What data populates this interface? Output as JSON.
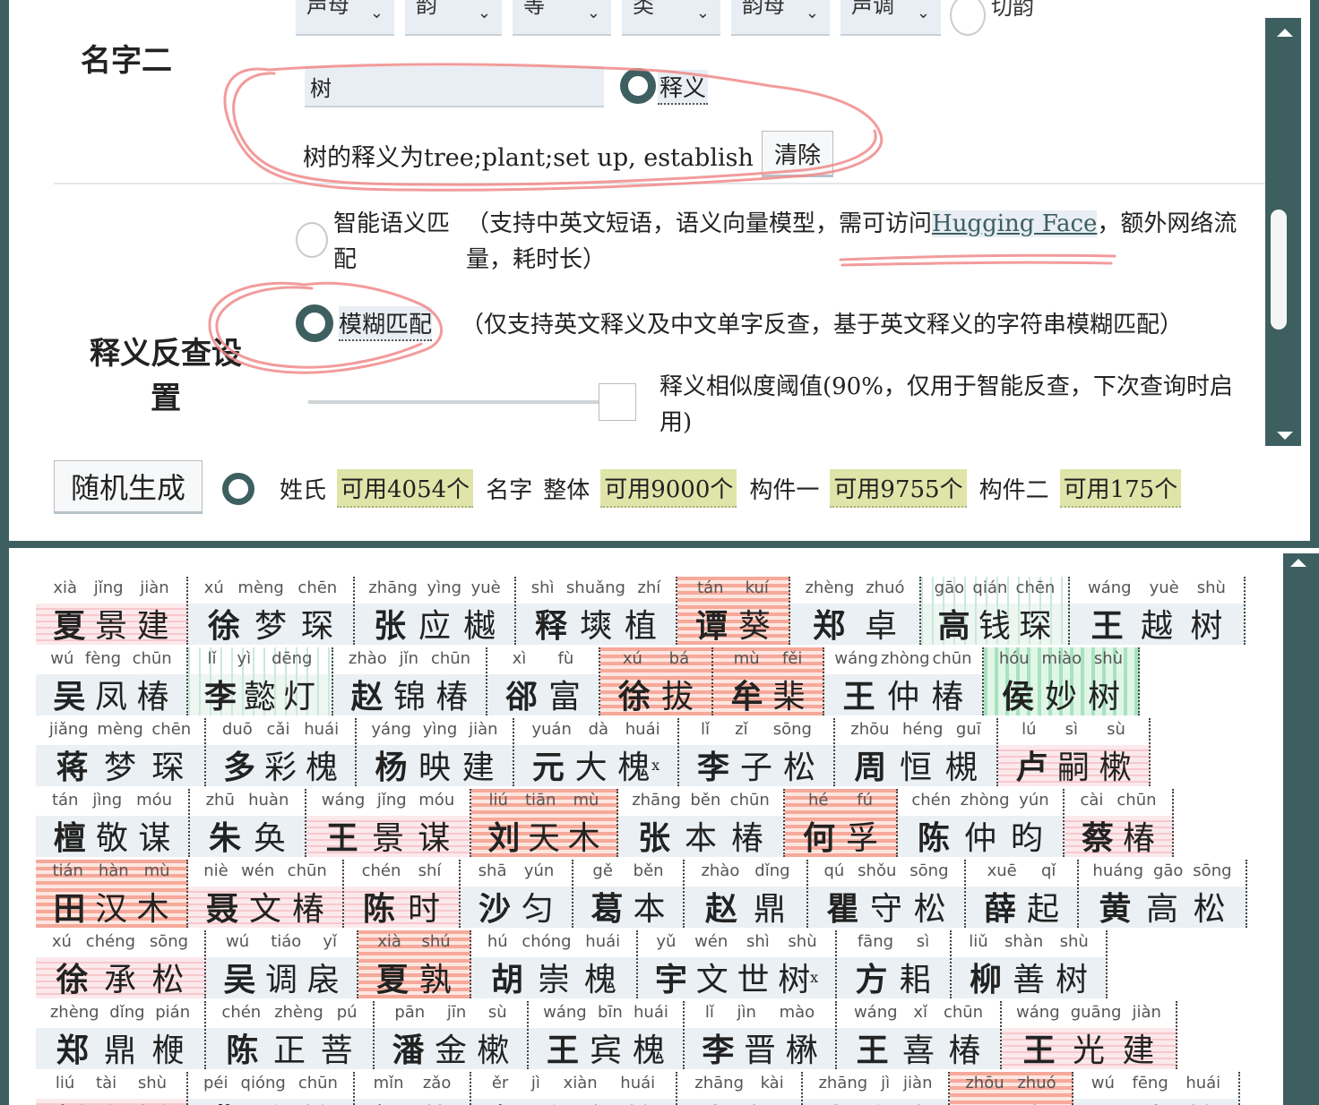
{
  "top": {
    "cut_selects": [
      {
        "label": "声母",
        "left": 0
      },
      {
        "label": "韵",
        "left": 0
      },
      {
        "label": "等",
        "left": 0
      },
      {
        "label": "类",
        "left": 0
      },
      {
        "label": "韵母",
        "left": 0
      },
      {
        "label": "声调",
        "left": 0
      }
    ],
    "cut_radio_label": "切韵",
    "name2_title": "名字二",
    "meaning_input_value": "树",
    "meaning_radio_label": "释义",
    "meaning_result": "树的释义为tree;plant;set up, establish",
    "clear_label": "清除",
    "meaning_setting_title": "释义反查设置",
    "smart_label": "智能语义匹配",
    "smart_desc_before": "（支持中英文短语，语义向量模型，需可访问",
    "smart_desc_link": "Hugging Face",
    "smart_desc_after": "，额外网络流量，耗时长）",
    "fuzzy_label": "模糊匹配",
    "fuzzy_desc": "（仅支持英文释义及中文单字反查，基于英文释义的字符串模糊匹配）",
    "slider_label": "释义相似度阈值(90%，仅用于智能反查，下次查询时启用)",
    "slider_value_percent": 90,
    "random_label": "随机生成",
    "gen_items": [
      {
        "text": "姓氏",
        "type": "plain"
      },
      {
        "text": "可用4054个",
        "type": "badge"
      },
      {
        "text": "名字",
        "type": "plain"
      },
      {
        "text": "整体",
        "type": "plain"
      },
      {
        "text": "可用9000个",
        "type": "badge"
      },
      {
        "text": "构件一",
        "type": "plain"
      },
      {
        "text": "可用9755个",
        "type": "badge"
      },
      {
        "text": "构件二",
        "type": "plain"
      },
      {
        "text": "可用175个",
        "type": "badge"
      }
    ]
  },
  "colors": {
    "accent": "#3d5f60",
    "input_bg": "#e8eef3",
    "badge_bg": "#dfe5a9",
    "red_stripe": "#f6a99a",
    "green_stripe": "#a7e3bd",
    "annotation": "#f08a8a"
  },
  "cards": [
    [
      {
        "py": [
          "xià",
          "jǐng",
          "jiàn"
        ],
        "hz": [
          "夏",
          "景",
          "建"
        ],
        "style": "pink",
        "w": 170
      },
      {
        "py": [
          "xú",
          "mèng",
          "chēn"
        ],
        "hz": [
          "徐",
          "梦",
          "琛"
        ],
        "style": "plain",
        "w": 186
      },
      {
        "py": [
          "zhāng",
          "yìng",
          "yuè"
        ],
        "hz": [
          "张",
          "应",
          "樾"
        ],
        "style": "plain",
        "w": 180
      },
      {
        "py": [
          "shì",
          "shuǎng",
          "zhí"
        ],
        "hz": [
          "释",
          "塽",
          "植"
        ],
        "style": "plain",
        "w": 180
      },
      {
        "py": [
          "tán",
          "kuí"
        ],
        "hz": [
          "谭",
          "葵"
        ],
        "style": "red",
        "w": 126
      },
      {
        "py": [
          "zhèng",
          "zhuó"
        ],
        "hz": [
          "郑",
          "卓"
        ],
        "style": "plain",
        "w": 146
      },
      {
        "py": [
          "gāo",
          "qián",
          "chēn"
        ],
        "hz": [
          "高",
          "钱",
          "琛"
        ],
        "style": "teal",
        "w": 166
      },
      {
        "py": [
          "wáng",
          "yuè",
          "shù"
        ],
        "hz": [
          "王",
          "越",
          "树"
        ],
        "style": "plain",
        "w": 196
      }
    ],
    [
      {
        "py": [
          "wú",
          "fèng",
          "chūn"
        ],
        "hz": [
          "吴",
          "凤",
          "椿"
        ],
        "style": "plain",
        "w": 170
      },
      {
        "py": [
          "lǐ",
          "yì",
          "dēng"
        ],
        "hz": [
          "李",
          "懿",
          "灯"
        ],
        "style": "teal",
        "w": 162
      },
      {
        "py": [
          "zhào",
          "jǐn",
          "chūn"
        ],
        "hz": [
          "赵",
          "锦",
          "椿"
        ],
        "style": "plain",
        "w": 172
      },
      {
        "py": [
          "xì",
          "fù"
        ],
        "hz": [
          "郤",
          "富"
        ],
        "style": "plain",
        "w": 126
      },
      {
        "py": [
          "xú",
          "bá"
        ],
        "hz": [
          "徐",
          "拔"
        ],
        "style": "red",
        "w": 126
      },
      {
        "py": [
          "mù",
          "fěi"
        ],
        "hz": [
          "牟",
          "棐"
        ],
        "style": "red",
        "w": 124
      },
      {
        "py": [
          "wáng",
          "zhòng",
          "chūn"
        ],
        "hz": [
          "王",
          "仲",
          "椿"
        ],
        "style": "plain",
        "w": 178
      },
      {
        "py": [
          "hóu",
          "miào",
          "shù"
        ],
        "hz": [
          "侯",
          "妙",
          "树"
        ],
        "style": "green",
        "w": 174
      }
    ],
    [
      {
        "py": [
          "jiǎng",
          "mèng",
          "chēn"
        ],
        "hz": [
          "蒋",
          "梦",
          "琛"
        ],
        "style": "plain",
        "w": 190
      },
      {
        "py": [
          "duō",
          "cǎi",
          "huái"
        ],
        "hz": [
          "多",
          "彩",
          "槐"
        ],
        "style": "plain",
        "w": 168
      },
      {
        "py": [
          "yáng",
          "yìng",
          "jiàn"
        ],
        "hz": [
          "杨",
          "映",
          "建"
        ],
        "style": "plain",
        "w": 176
      },
      {
        "py": [
          "yuán",
          "dà",
          "huái"
        ],
        "hz": [
          "元",
          "大",
          "槐"
        ],
        "style": "plain",
        "w": 184,
        "mark": "x"
      },
      {
        "py": [
          "lǐ",
          "zǐ",
          "sōng"
        ],
        "hz": [
          "李",
          "子",
          "松"
        ],
        "style": "plain",
        "w": 174
      },
      {
        "py": [
          "zhōu",
          "héng",
          "guī"
        ],
        "hz": [
          "周",
          "恒",
          "槻"
        ],
        "style": "plain",
        "w": 182
      },
      {
        "py": [
          "lú",
          "sì",
          "sù"
        ],
        "hz": [
          "卢",
          "嗣",
          "樕"
        ],
        "style": "pink",
        "w": 170
      }
    ],
    [
      {
        "py": [
          "tán",
          "jìng",
          "móu"
        ],
        "hz": [
          "檀",
          "敬",
          "谋"
        ],
        "style": "plain",
        "w": 172
      },
      {
        "py": [
          "zhū",
          "huàn"
        ],
        "hz": [
          "朱",
          "奂"
        ],
        "style": "plain",
        "w": 130
      },
      {
        "py": [
          "wáng",
          "jǐng",
          "móu"
        ],
        "hz": [
          "王",
          "景",
          "谋"
        ],
        "style": "pink",
        "w": 184
      },
      {
        "py": [
          "liú",
          "tiān",
          "mù"
        ],
        "hz": [
          "刘",
          "天",
          "木"
        ],
        "style": "red",
        "w": 164
      },
      {
        "py": [
          "zhāng",
          "běn",
          "chūn"
        ],
        "hz": [
          "张",
          "本",
          "椿"
        ],
        "style": "plain",
        "w": 186
      },
      {
        "py": [
          "hé",
          "fú"
        ],
        "hz": [
          "何",
          "孚"
        ],
        "style": "red",
        "w": 126
      },
      {
        "py": [
          "chén",
          "zhòng",
          "yún"
        ],
        "hz": [
          "陈",
          "仲",
          "昀"
        ],
        "style": "plain",
        "w": 186
      },
      {
        "py": [
          "cài",
          "chūn"
        ],
        "hz": [
          "蔡",
          "椿"
        ],
        "style": "pink",
        "w": 122
      }
    ],
    [
      {
        "py": [
          "tián",
          "hàn",
          "mù"
        ],
        "hz": [
          "田",
          "汉",
          "木"
        ],
        "style": "red",
        "w": 170
      },
      {
        "py": [
          "niè",
          "wén",
          "chūn"
        ],
        "hz": [
          "聂",
          "文",
          "椿"
        ],
        "style": "pink",
        "w": 174
      },
      {
        "py": [
          "chén",
          "shí"
        ],
        "hz": [
          "陈",
          "时"
        ],
        "style": "pink",
        "w": 130
      },
      {
        "py": [
          "shā",
          "yún"
        ],
        "hz": [
          "沙",
          "匀"
        ],
        "style": "plain",
        "w": 126
      },
      {
        "py": [
          "gě",
          "běn"
        ],
        "hz": [
          "葛",
          "本"
        ],
        "style": "plain",
        "w": 124
      },
      {
        "py": [
          "zhào",
          "dǐng"
        ],
        "hz": [
          "赵",
          "鼎"
        ],
        "style": "plain",
        "w": 138
      },
      {
        "py": [
          "qú",
          "shǒu",
          "sōng"
        ],
        "hz": [
          "瞿",
          "守",
          "松"
        ],
        "style": "plain",
        "w": 176
      },
      {
        "py": [
          "xuē",
          "qǐ"
        ],
        "hz": [
          "薛",
          "起"
        ],
        "style": "plain",
        "w": 126
      },
      {
        "py": [
          "huáng",
          "gāo",
          "sōng"
        ],
        "hz": [
          "黄",
          "高",
          "松"
        ],
        "style": "plain",
        "w": 188
      }
    ],
    [
      {
        "py": [
          "xú",
          "chéng",
          "sōng"
        ],
        "hz": [
          "徐",
          "承",
          "松"
        ],
        "style": "pink",
        "w": 190
      },
      {
        "py": [
          "wú",
          "tiáo",
          "yǐ"
        ],
        "hz": [
          "吴",
          "调",
          "扆"
        ],
        "style": "plain",
        "w": 170
      },
      {
        "py": [
          "xià",
          "shú"
        ],
        "hz": [
          "夏",
          "孰"
        ],
        "style": "red",
        "w": 126
      },
      {
        "py": [
          "hú",
          "chóng",
          "huái"
        ],
        "hz": [
          "胡",
          "崇",
          "槐"
        ],
        "style": "plain",
        "w": 186
      },
      {
        "py": [
          "yǔ",
          "wén",
          "shì",
          "shù"
        ],
        "hz": [
          "宇",
          "文",
          "世",
          "树"
        ],
        "style": "plain",
        "w": 222,
        "mark": "x"
      },
      {
        "py": [
          "fāng",
          "sì"
        ],
        "hz": [
          "方",
          "耜"
        ],
        "style": "plain",
        "w": 128
      },
      {
        "py": [
          "liǔ",
          "shàn",
          "shù"
        ],
        "hz": [
          "柳",
          "善",
          "树"
        ],
        "style": "plain",
        "w": 174
      }
    ],
    [
      {
        "py": [
          "zhèng",
          "dǐng",
          "pián"
        ],
        "hz": [
          "郑",
          "鼎",
          "楩"
        ],
        "style": "plain",
        "w": 190
      },
      {
        "py": [
          "chén",
          "zhèng",
          "pú"
        ],
        "hz": [
          "陈",
          "正",
          "菩"
        ],
        "style": "plain",
        "w": 188
      },
      {
        "py": [
          "pān",
          "jīn",
          "sù"
        ],
        "hz": [
          "潘",
          "金",
          "樕"
        ],
        "style": "plain",
        "w": 172
      },
      {
        "py": [
          "wáng",
          "bīn",
          "huái"
        ],
        "hz": [
          "王",
          "宾",
          "槐"
        ],
        "style": "plain",
        "w": 174
      },
      {
        "py": [
          "lǐ",
          "jìn",
          "mào"
        ],
        "hz": [
          "李",
          "晋",
          "楙"
        ],
        "style": "plain",
        "w": 170
      },
      {
        "py": [
          "wáng",
          "xǐ",
          "chūn"
        ],
        "hz": [
          "王",
          "喜",
          "椿"
        ],
        "style": "plain",
        "w": 184
      },
      {
        "py": [
          "wáng",
          "guāng",
          "jiàn"
        ],
        "hz": [
          "王",
          "光",
          "建"
        ],
        "style": "pink",
        "w": 196
      }
    ],
    [
      {
        "py": [
          "liú",
          "tài",
          "shù"
        ],
        "hz": [
          "刘",
          "泰",
          "树"
        ],
        "style": "pink",
        "w": 170
      },
      {
        "py": [
          "péi",
          "qióng",
          "chūn"
        ],
        "hz": [
          "裴",
          "琼",
          "椿"
        ],
        "style": "plain",
        "w": 186
      },
      {
        "py": [
          "mǐn",
          "zǎo"
        ],
        "hz": [
          "闵",
          "藻"
        ],
        "style": "plain",
        "w": 130
      },
      {
        "py": [
          "ěr",
          "jì",
          "xiàn",
          "huái"
        ],
        "hz": [
          "尔",
          "济",
          "宪",
          "槐"
        ],
        "style": "plain",
        "w": 230
      },
      {
        "py": [
          "zhāng",
          "kài"
        ],
        "hz": [
          "张",
          "忾"
        ],
        "style": "plain",
        "w": 140
      },
      {
        "py": [
          "zhāng",
          "jì",
          "jiàn"
        ],
        "hz": [
          "张",
          "济",
          "建"
        ],
        "style": "plain",
        "w": 164
      },
      {
        "py": [
          "zhōu",
          "zhuó"
        ],
        "hz": [
          "周",
          "卓"
        ],
        "style": "red",
        "w": 138
      },
      {
        "py": [
          "wú",
          "fēng",
          "huái"
        ],
        "hz": [
          "吴",
          "丰",
          "槐"
        ],
        "style": "plain",
        "w": 186
      }
    ]
  ]
}
